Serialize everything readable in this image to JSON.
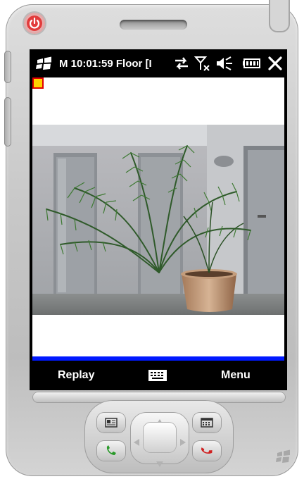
{
  "status_bar": {
    "title": "M 10:01:59 Floor [I",
    "icons": [
      "windows-start-icon",
      "sync-arrows-icon",
      "no-signal-icon",
      "speaker-muted-icon",
      "battery-icon",
      "close-icon"
    ]
  },
  "softkeys": {
    "left_label": "Replay",
    "center_icon": "keyboard-icon",
    "right_label": "Menu"
  },
  "recording_indicator": {
    "color": "#ffd100",
    "border_color": "#e00000"
  },
  "accent": {
    "separator_bar": "#0019ff"
  },
  "hardware": {
    "buttons": [
      "power-icon",
      "contacts-icon",
      "calendar-icon",
      "call-answer-icon",
      "call-end-icon",
      "windows-logo-icon"
    ]
  }
}
